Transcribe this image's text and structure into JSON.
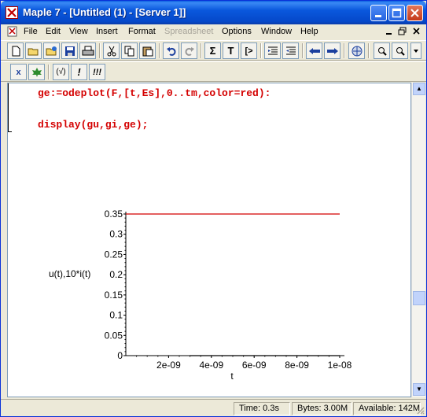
{
  "window": {
    "title": "Maple 7  - [Untitled (1) - [Server 1]]"
  },
  "menu": {
    "items": [
      {
        "label": "File",
        "disabled": false
      },
      {
        "label": "Edit",
        "disabled": false
      },
      {
        "label": "View",
        "disabled": false
      },
      {
        "label": "Insert",
        "disabled": false
      },
      {
        "label": "Format",
        "disabled": false
      },
      {
        "label": "Spreadsheet",
        "disabled": true
      },
      {
        "label": "Options",
        "disabled": false
      },
      {
        "label": "Window",
        "disabled": false
      },
      {
        "label": "Help",
        "disabled": false
      }
    ]
  },
  "toolbar": {
    "sum_label": "Σ",
    "text_label": "T",
    "prompt_label": "[>",
    "context_eval_label": "(√)",
    "context_bang_label": "!",
    "context_bang3_label": "!!!",
    "context_x_label": "x"
  },
  "worksheet": {
    "lines": [
      "ge:=odeplot(F,[t,Es],0..tm,color=red):",
      "display(gu,gi,ge);"
    ]
  },
  "chart_data": {
    "type": "line",
    "title": "",
    "xlabel": "t",
    "ylabel": "u(t),10*i(t)",
    "xlim": [
      0,
      1e-08
    ],
    "ylim": [
      0,
      0.35
    ],
    "x_tick_labels": [
      "2e-09",
      "4e-09",
      "6e-09",
      "8e-09",
      "1e-08"
    ],
    "x_ticks": [
      2e-09,
      4e-09,
      6e-09,
      8e-09,
      1e-08
    ],
    "y_tick_labels": [
      "0",
      "0.05",
      "0.1",
      "0.15",
      "0.2",
      "0.25",
      "0.3",
      "0.35"
    ],
    "y_ticks": [
      0,
      0.05,
      0.1,
      0.15,
      0.2,
      0.25,
      0.3,
      0.35
    ],
    "grid": false,
    "series": [
      {
        "color": "#d40000",
        "x": [
          0,
          1e-08
        ],
        "values": [
          0.35,
          0.35
        ]
      },
      {
        "color": "#000000",
        "x": [
          3e-09,
          1e-08
        ],
        "values": [
          0.0,
          0.0
        ]
      }
    ]
  },
  "status": {
    "time": "Time:  0.3s",
    "bytes": "Bytes: 3.00M",
    "available": "Available: 142M"
  },
  "colors": {
    "titlebar": "#0a58dd",
    "code": "#d40000",
    "plot_line": "#d40000"
  }
}
